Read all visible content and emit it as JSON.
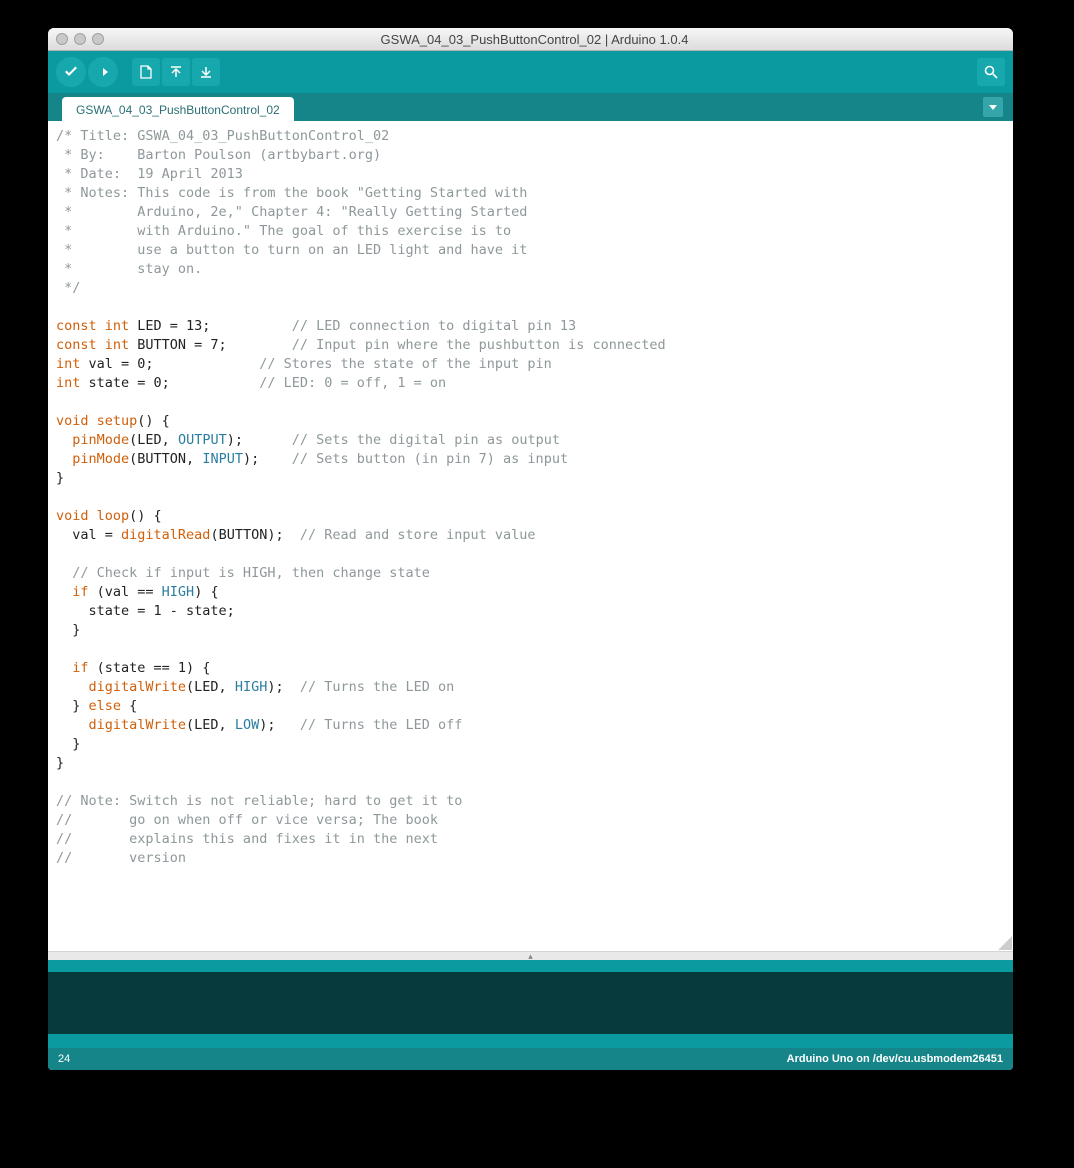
{
  "window": {
    "title": "GSWA_04_03_PushButtonControl_02 | Arduino 1.0.4"
  },
  "toolbar": {
    "verify_tip": "Verify",
    "upload_tip": "Upload",
    "new_tip": "New",
    "open_tip": "Open",
    "save_tip": "Save",
    "monitor_tip": "Serial Monitor"
  },
  "tabs": {
    "active": "GSWA_04_03_PushButtonControl_02"
  },
  "code": {
    "c01": "/* Title: GSWA_04_03_PushButtonControl_02",
    "c02": " * By:    Barton Poulson (artbybart.org)",
    "c03": " * Date:  19 April 2013",
    "c04": " * Notes: This code is from the book \"Getting Started with",
    "c05": " *        Arduino, 2e,\" Chapter 4: \"Really Getting Started",
    "c06": " *        with Arduino.\" The goal of this exercise is to",
    "c07": " *        use a button to turn on an LED light and have it",
    "c08": " *        stay on.",
    "c09": " */",
    "kw_const1": "const int",
    "led_decl": " LED = 13;",
    "cm_led": "          // LED connection to digital pin 13",
    "kw_const2": "const int",
    "btn_decl": " BUTTON = 7;",
    "cm_btn": "        // Input pin where the pushbutton is connected",
    "kw_int1": "int",
    "val_decl": " val = 0;",
    "cm_val": "             // Stores the state of the input pin",
    "kw_int2": "int",
    "state_decl": " state = 0;",
    "cm_state": "           // LED: 0 = off, 1 = on",
    "kw_void1": "void",
    "fn_setup": " setup",
    "setup_paren": "() {",
    "pm1a": "  pinMode",
    "pm1b": "(LED, ",
    "pm1c": "OUTPUT",
    "pm1d": ");",
    "cm_pm1": "      // Sets the digital pin as output",
    "pm2a": "  pinMode",
    "pm2b": "(BUTTON, ",
    "pm2c": "INPUT",
    "pm2d": ");",
    "cm_pm2": "    // Sets button (in pin 7) as input",
    "close1": "}",
    "kw_void2": "void",
    "fn_loop": " loop",
    "loop_paren": "() {",
    "vr1": "  val = ",
    "vr1b": "digitalRead",
    "vr1c": "(BUTTON);",
    "cm_vr1": "  // Read and store input value",
    "blank": "",
    "cm_chk": "  // Check if input is HIGH, then change state",
    "if1a": "  if",
    "if1b": " (val == ",
    "if1c": "HIGH",
    "if1d": ") {",
    "st1": "    state = 1 - state;",
    "close2": "  }",
    "if2a": "  if",
    "if2b": " (state == 1) {",
    "dw1a": "    digitalWrite",
    "dw1b": "(LED, ",
    "dw1c": "HIGH",
    "dw1d": ");",
    "cm_dw1": "  // Turns the LED on",
    "else1": "  } ",
    "else1b": "else",
    "else1c": " {",
    "dw2a": "    digitalWrite",
    "dw2b": "(LED, ",
    "dw2c": "LOW",
    "dw2d": ");",
    "cm_dw2": "   // Turns the LED off",
    "close3": "  }",
    "close4": "}",
    "n1": "// Note: Switch is not reliable; hard to get it to",
    "n2": "//       go on when off or vice versa; The book",
    "n3": "//       explains this and fixes it in the next",
    "n4": "//       version"
  },
  "status": {
    "line": "24",
    "board": "Arduino Uno on /dev/cu.usbmodem26451"
  }
}
